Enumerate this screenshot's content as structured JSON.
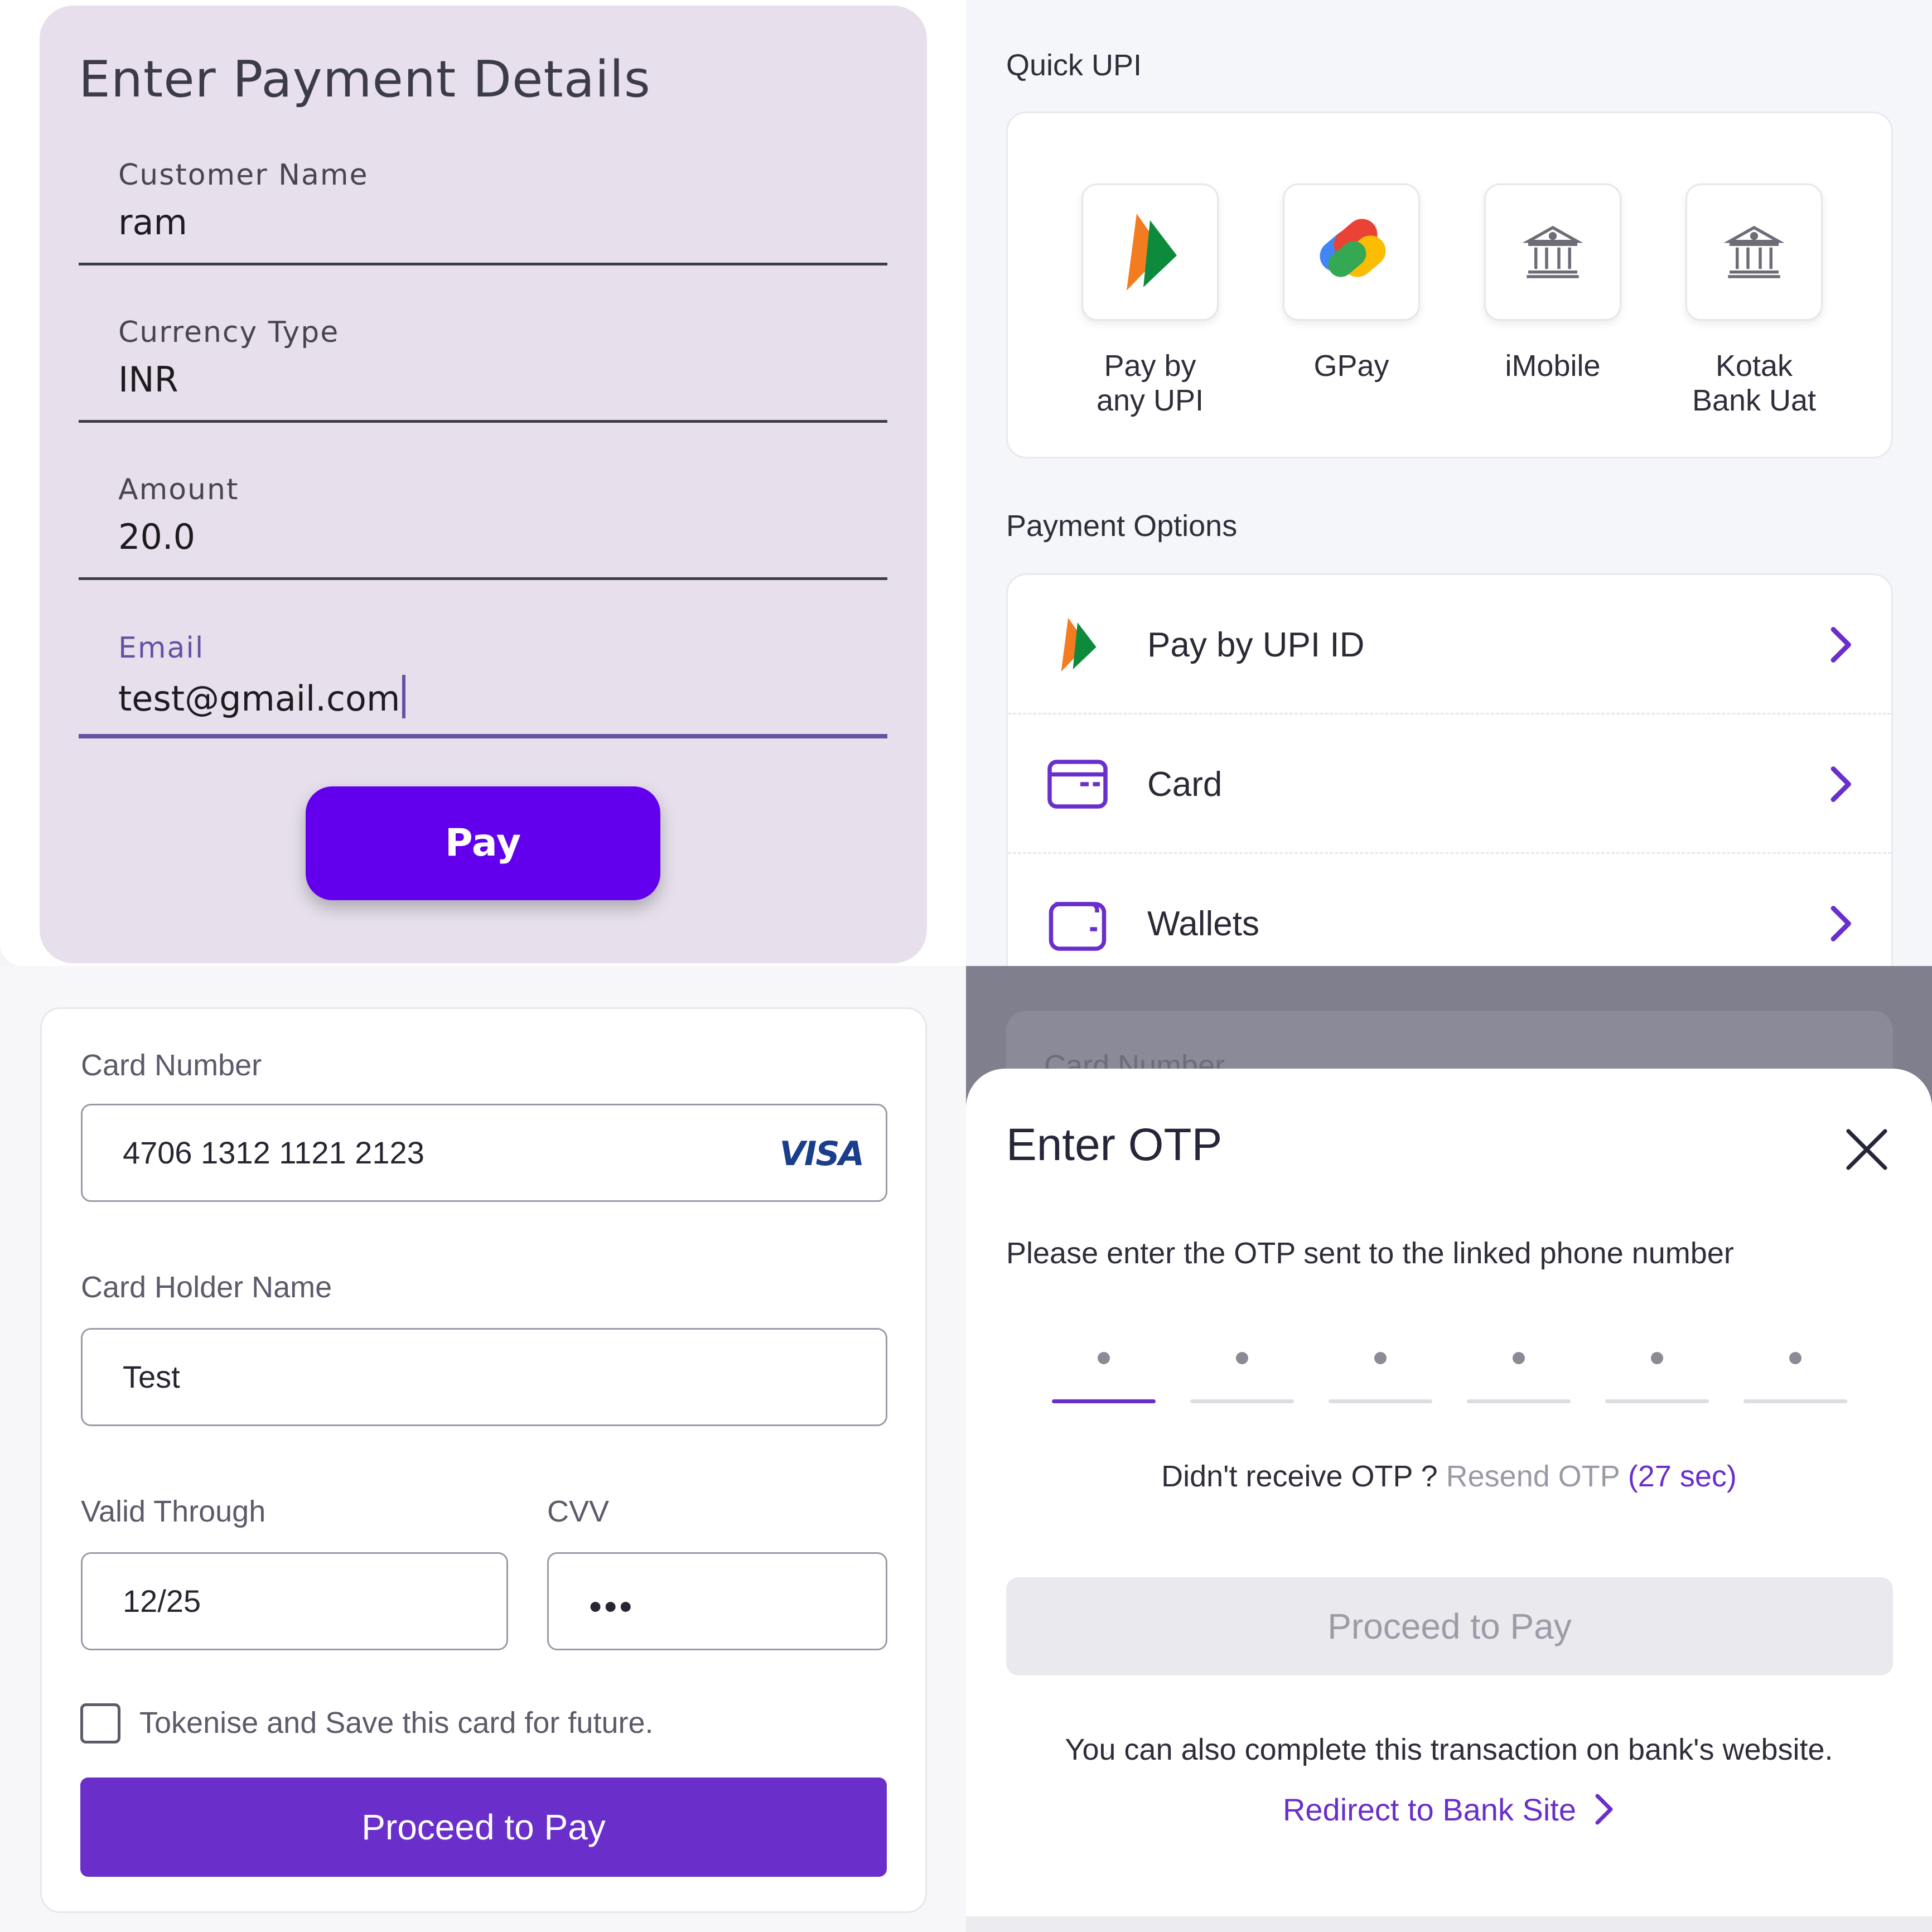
{
  "payment_form": {
    "title": "Enter Payment Details",
    "fields": [
      {
        "label": "Customer Name",
        "value": "ram"
      },
      {
        "label": "Currency Type",
        "value": "INR"
      },
      {
        "label": "Amount",
        "value": "20.0"
      },
      {
        "label": "Email",
        "value": "test@gmail.com"
      }
    ],
    "pay_label": "Pay",
    "accent": "#6200ee"
  },
  "quick_upi": {
    "title": "Quick UPI",
    "apps": [
      {
        "name": "Pay by any UPI",
        "icon": "bhim-upi-icon"
      },
      {
        "name": "GPay",
        "icon": "gpay-icon"
      },
      {
        "name": "iMobile",
        "icon": "bank-icon"
      },
      {
        "name": "Kotak Bank Uat",
        "icon": "bank-icon"
      }
    ]
  },
  "payment_options": {
    "title": "Payment Options",
    "items": [
      {
        "label": "Pay by UPI ID",
        "icon": "bhim-upi-icon"
      },
      {
        "label": "Card",
        "icon": "card-icon"
      },
      {
        "label": "Wallets",
        "icon": "wallet-icon"
      }
    ]
  },
  "card_form": {
    "card_number_label": "Card Number",
    "card_number": "4706 1312 1121 2123",
    "brand": "VISA",
    "holder_label": "Card Holder Name",
    "holder": "Test",
    "valid_label": "Valid Through",
    "valid": "12/25",
    "cvv_label": "CVV",
    "cvv": "•••",
    "save_label": "Tokenise and Save this card for future.",
    "proceed_label": "Proceed to Pay",
    "accent": "#6a2fcb"
  },
  "otp": {
    "background_label": "Card Number",
    "title": "Enter OTP",
    "message": "Please enter the OTP sent to the linked phone number",
    "digits": 6,
    "resend_prefix": "Didn't receive OTP ?",
    "resend_label": "Resend OTP",
    "timer": "(27 sec)",
    "proceed_label": "Proceed to Pay",
    "bank_note": "You can also complete this transaction on bank's website.",
    "redirect_label": "Redirect to Bank Site"
  }
}
